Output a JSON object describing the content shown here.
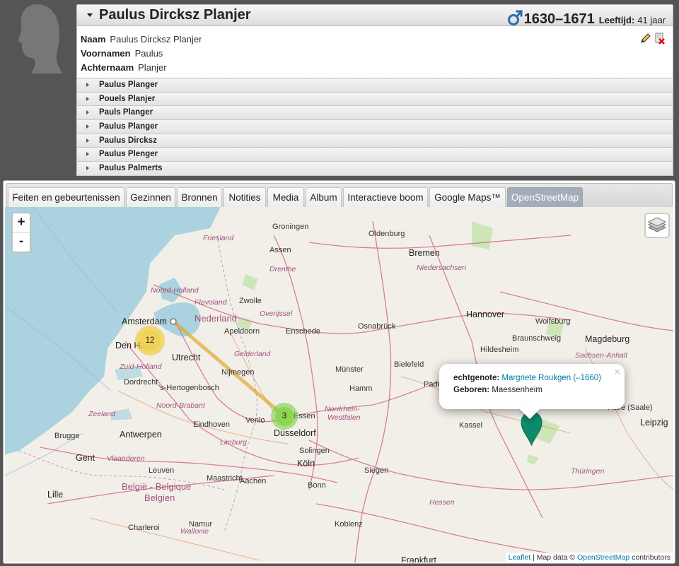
{
  "person": {
    "name": "Paulus Dircksz Planjer",
    "years": "1630–1671",
    "age_label": "Leeftijd:",
    "age_value": "41 jaar"
  },
  "names": {
    "naam_label": "Naam",
    "naam_value": "Paulus Dircksz Planjer",
    "voornamen_label": "Voornamen",
    "voornamen_value": "Paulus",
    "achternaam_label": "Achternaam",
    "achternaam_value": "Planjer"
  },
  "alt_names": [
    "Paulus Planger",
    "Pouels Planjer",
    "Pauls Planger",
    "Paulus Planger",
    "Paulus Dircksz",
    "Paulus Plenger",
    "Paulus Palmerts"
  ],
  "tabs": [
    "Feiten en gebeurtenissen",
    "Gezinnen",
    "Bronnen",
    "Notities",
    "Media",
    "Album",
    "Interactieve boom",
    "Google Maps™",
    "OpenStreetMap"
  ],
  "active_tab": "OpenStreetMap",
  "map": {
    "zoom_in": "+",
    "zoom_out": "-",
    "clusters": [
      "12",
      "3"
    ],
    "popup": {
      "close": "×",
      "spouse_label": "echtgenote:",
      "spouse_value": "Margriete Roukgen (–1660)",
      "born_label": "Geboren:",
      "born_value": "Maessenheim"
    },
    "attribution": {
      "leaflet": "Leaflet",
      "sep": " | Map data © ",
      "osm": "OpenStreetMap",
      "contributors": " contributors"
    },
    "cities": {
      "groningen": "Groningen",
      "assen": "Assen",
      "oldenburg": "Oldenburg",
      "bremen": "Bremen",
      "amsterdam": "Amsterdam",
      "den_haag": "Den Haag",
      "utrecht": "Utrecht",
      "zwolle": "Zwolle",
      "apeldoorn": "Apeldoorn",
      "enschede": "Enschede",
      "osnabruck": "Osnabrück",
      "hannover": "Hannover",
      "wolfsburg": "Wolfsburg",
      "braunschweig": "Braunschweig",
      "magdeburg": "Magdeburg",
      "hildesheim": "Hildesheim",
      "dordrecht": "Dordrecht",
      "nijmegen": "Nijmegen",
      "shertogenbosch": "'s-Hertogenbosch",
      "munster": "Münster",
      "hamm": "Hamm",
      "bielefeld": "Bielefeld",
      "paderborn": "Paderborn",
      "eindhoven": "Eindhoven",
      "venlo": "Venlo",
      "dusseldorf": "Düsseldorf",
      "essen": "Essen",
      "kassel": "Kassel",
      "halle": "Halle (Saale)",
      "leipzig": "Leipzig",
      "antwerpen": "Antwerpen",
      "brugge": "Brugge",
      "gent": "Gent",
      "solingen": "Solingen",
      "koln": "Köln",
      "leuven": "Leuven",
      "maastricht": "Maastricht",
      "aachen": "Aachen",
      "bonn": "Bonn",
      "siegen": "Siegen",
      "lille": "Lille",
      "charleroi": "Charleroi",
      "namur": "Namur",
      "koblenz": "Koblenz",
      "frankfurt": "Frankfurt"
    },
    "regions": {
      "friesland": "Friesland",
      "drenthe": "Drenthe",
      "noord_holland": "Noord-Holland",
      "flevoland": "Flevoland",
      "overijssel": "Overijssel",
      "niedersachsen": "Niedersachsen",
      "gelderland": "Gelderland",
      "zuid_holland": "Zuid-Holland",
      "noord_brabant": "Noord-Brabant",
      "zeeland": "Zeeland",
      "limburg": "Limburg",
      "vlaanderen": "Vlaanderen",
      "wallonie": "Wallonie",
      "nrw1": "Nordrhein-",
      "nrw2": "Westfalen",
      "sachsen_anhalt": "Sachsen-Anhalt",
      "thuringen": "Thüringen",
      "hessen": "Hessen"
    },
    "countries": {
      "nederland": "Nederland",
      "belgie": "België - Belgique",
      "belgien": "Belgien"
    }
  }
}
